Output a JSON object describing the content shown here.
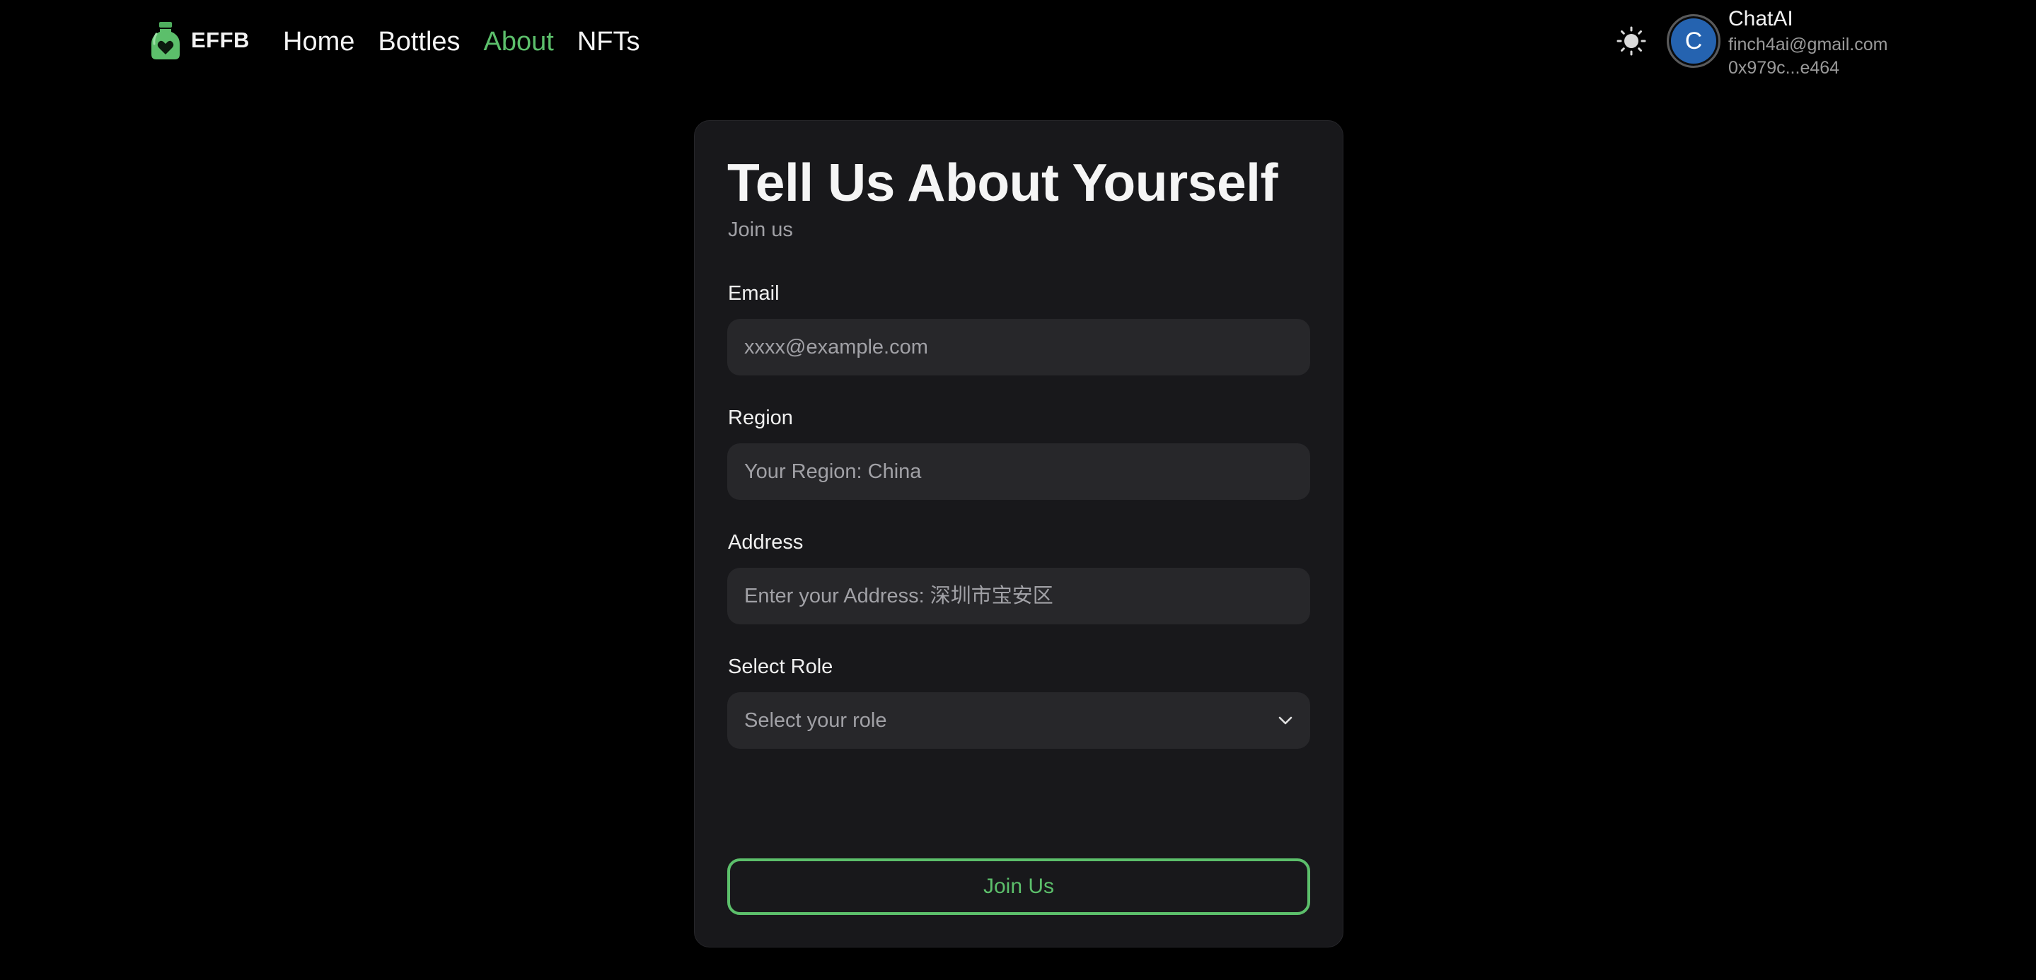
{
  "nav": {
    "brand": "EFFB",
    "links": [
      {
        "label": "Home",
        "active": false
      },
      {
        "label": "Bottles",
        "active": false
      },
      {
        "label": "About",
        "active": true
      },
      {
        "label": "NFTs",
        "active": false
      }
    ]
  },
  "user": {
    "avatar_initial": "C",
    "name": "ChatAI",
    "email": "finch4ai@gmail.com",
    "wallet": "0x979c...e464"
  },
  "form": {
    "title": "Tell Us About Yourself",
    "subtitle": "Join us",
    "email": {
      "label": "Email",
      "placeholder": "xxxx@example.com",
      "value": ""
    },
    "region": {
      "label": "Region",
      "placeholder": "Your Region: China",
      "value": ""
    },
    "address": {
      "label": "Address",
      "placeholder": "Enter your Address: 深圳市宝安区",
      "value": ""
    },
    "role": {
      "label": "Select Role",
      "selected": "Select your role"
    },
    "submit_label": "Join Us"
  },
  "colors": {
    "accent": "#5cbf6b",
    "background": "#000000",
    "card": "#18181b",
    "input": "#27272a",
    "avatar": "#2563b0"
  },
  "icons": {
    "brand": "bottle-logo-icon",
    "theme": "sun-icon",
    "select": "chevron-down-icon"
  }
}
